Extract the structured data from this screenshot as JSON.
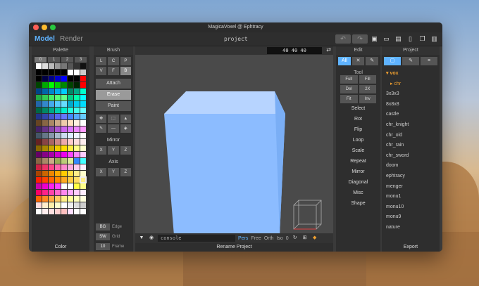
{
  "window": {
    "title": "MagicaVoxel @ Ephtracy"
  },
  "toolbar": {
    "tabs": [
      "Model",
      "Render"
    ],
    "project_name": "project",
    "undo": "↶",
    "redo": "↷",
    "icons": [
      "save-icon",
      "open-folder-icon",
      "save-as-icon",
      "new-file-icon",
      "duplicate-icon",
      "delete-icon"
    ]
  },
  "palette": {
    "title": "Palette",
    "tabs": [
      "0",
      "1",
      "2",
      "3"
    ],
    "footer": "Color",
    "colors": [
      "#ffffff",
      "#dddddd",
      "#bbbbbb",
      "#999999",
      "#777777",
      "#555555",
      "#333333",
      "#111111",
      "#000000",
      "#000000",
      "#000000",
      "#000000",
      "#000000",
      "#ffffff",
      "#ffffff",
      "#cccccc",
      "#000000",
      "#000044",
      "#000088",
      "#0000cc",
      "#0000ff",
      "#000000",
      "#000000",
      "#ff0000",
      "#004400",
      "#00aa00",
      "#00ff00",
      "#00cc00",
      "#008800",
      "#004400",
      "#002200",
      "#ff0000",
      "#004488",
      "#0066aa",
      "#0088cc",
      "#00aaee",
      "#00ccff",
      "#008866",
      "#00aa88",
      "#00ffcc",
      "#22aa44",
      "#33cc55",
      "#44ee66",
      "#55ff77",
      "#66ff88",
      "#00cc88",
      "#00ffaa",
      "#00ffff",
      "#2266aa",
      "#3388cc",
      "#44aaee",
      "#55ccff",
      "#66ddff",
      "#00aacc",
      "#00ccee",
      "#00ddff",
      "#006644",
      "#008866",
      "#00aa88",
      "#00ccaa",
      "#00eecc",
      "#22ffdd",
      "#44ffee",
      "#66ffff",
      "#223388",
      "#3344aa",
      "#4455cc",
      "#5566ee",
      "#6677ff",
      "#4488ff",
      "#55aaff",
      "#66ccff",
      "#664422",
      "#886644",
      "#aa8866",
      "#ccaa88",
      "#eeccaa",
      "#ffe0c0",
      "#fff0e0",
      "#ffffff",
      "#442266",
      "#663388",
      "#8844aa",
      "#aa55cc",
      "#cc66ee",
      "#dd77ff",
      "#ee88ff",
      "#ff99ff",
      "#445566",
      "#667788",
      "#8899aa",
      "#aabbcc",
      "#ccddee",
      "#ddeeff",
      "#eef4ff",
      "#ffffff",
      "#662222",
      "#884444",
      "#aa6666",
      "#cc8888",
      "#eeaaaa",
      "#ffcccc",
      "#ffdddd",
      "#ffeeee",
      "#886600",
      "#aa8800",
      "#ccaa00",
      "#eecc00",
      "#ffdd00",
      "#ffee44",
      "#ffff88",
      "#ffffcc",
      "#660066",
      "#880088",
      "#aa00aa",
      "#cc00cc",
      "#ee00ee",
      "#ff44ff",
      "#ff88ff",
      "#ffccff",
      "#886644",
      "#aa8866",
      "#ccaa88",
      "#99aa55",
      "#bbcc77",
      "#ddee99",
      "#3388ff",
      "#44ffff",
      "#cc2244",
      "#ee3366",
      "#ff4488",
      "#ff66aa",
      "#ff88cc",
      "#ffaadd",
      "#ffccee",
      "#ffeeff",
      "#aa4400",
      "#cc6600",
      "#ee8800",
      "#ffaa00",
      "#ffcc00",
      "#ffdd44",
      "#ffee88",
      "#ffffcc",
      "#ff2200",
      "#ff4400",
      "#ff6600",
      "#ff8800",
      "#ffaa22",
      "#ffcc44",
      "#ffdd66",
      "#ffee88",
      "#cc00aa",
      "#ee00cc",
      "#ff22ee",
      "#ff44ff",
      "#ffffff",
      "#ffffff",
      "#ffff44",
      "#ffff88",
      "#ff0066",
      "#ff2288",
      "#ff44aa",
      "#ff66cc",
      "#ff88ee",
      "#ffaaff",
      "#ffccff",
      "#ffeeff",
      "#ff6600",
      "#ff8822",
      "#ffaa44",
      "#ffcc66",
      "#ffee88",
      "#ffff99",
      "#ffffbb",
      "#ffffdd",
      "#ffdddd",
      "#ffeecc",
      "#ffeeaa",
      "#ffffcc",
      "#ffffff",
      "#eeeeee",
      "#dddddd",
      "#cccccc",
      "#ffffff",
      "#ffeeee",
      "#ffe0e0",
      "#ffd0d0",
      "#ffc0c0",
      "#ffe0ff",
      "#ffffff",
      "#ffffff"
    ],
    "selected_index": 151
  },
  "brush": {
    "title": "Brush",
    "types": [
      "L",
      "C",
      "P",
      "V",
      "F",
      "B"
    ],
    "modes": [
      "Attach",
      "Erase",
      "Paint"
    ],
    "tools": [
      "move-icon",
      "select-icon",
      "fill-icon",
      "pick-icon",
      "line-icon",
      "bucket-icon"
    ],
    "mirror_title": "Mirror",
    "mirror": [
      "X",
      "Y",
      "Z"
    ],
    "axis_title": "Axis",
    "axis": [
      "X",
      "Y",
      "Z"
    ],
    "bg_key": "BG",
    "bg_label": "Edge",
    "sw_key": "SW",
    "sw_label": "Grid",
    "frame_key": "10",
    "frame_label": "Frame"
  },
  "viewport": {
    "size": "40  40  40",
    "swap": "⇄",
    "console": "console",
    "modes": [
      "Pers",
      "Free",
      "Orth",
      "Iso"
    ],
    "zero": "0",
    "status": "Rename Project",
    "cube_color": "#8cbcff"
  },
  "edit": {
    "title": "Edit",
    "tabs": [
      "All",
      "✕",
      "✎"
    ],
    "tool_title": "Tool",
    "tools": [
      "Full",
      "Fill",
      "Del",
      "2X",
      "Fit",
      "Inv"
    ],
    "actions": [
      "Select",
      "Rot",
      "Flip",
      "Loop",
      "Scale",
      "Repeat",
      "Mirror",
      "Diagonal",
      "Misc",
      "Shape"
    ]
  },
  "project": {
    "title": "Project",
    "tabs": [
      "▢",
      "✎",
      "≡"
    ],
    "items": [
      {
        "label": "▾ vox",
        "kind": "folder"
      },
      {
        "label": "▸ chr",
        "kind": "sub"
      },
      {
        "label": "3x3x3",
        "kind": "file"
      },
      {
        "label": "8x8x8",
        "kind": "file"
      },
      {
        "label": "castle",
        "kind": "file"
      },
      {
        "label": "chr_knight",
        "kind": "file"
      },
      {
        "label": "chr_old",
        "kind": "file"
      },
      {
        "label": "chr_rain",
        "kind": "file"
      },
      {
        "label": "chr_sword",
        "kind": "file"
      },
      {
        "label": "doom",
        "kind": "file"
      },
      {
        "label": "ephtracy",
        "kind": "file"
      },
      {
        "label": "menger",
        "kind": "file"
      },
      {
        "label": "monu1",
        "kind": "file"
      },
      {
        "label": "monu10",
        "kind": "file"
      },
      {
        "label": "monu9",
        "kind": "file"
      },
      {
        "label": "nature",
        "kind": "file"
      }
    ],
    "footer": "Export"
  }
}
